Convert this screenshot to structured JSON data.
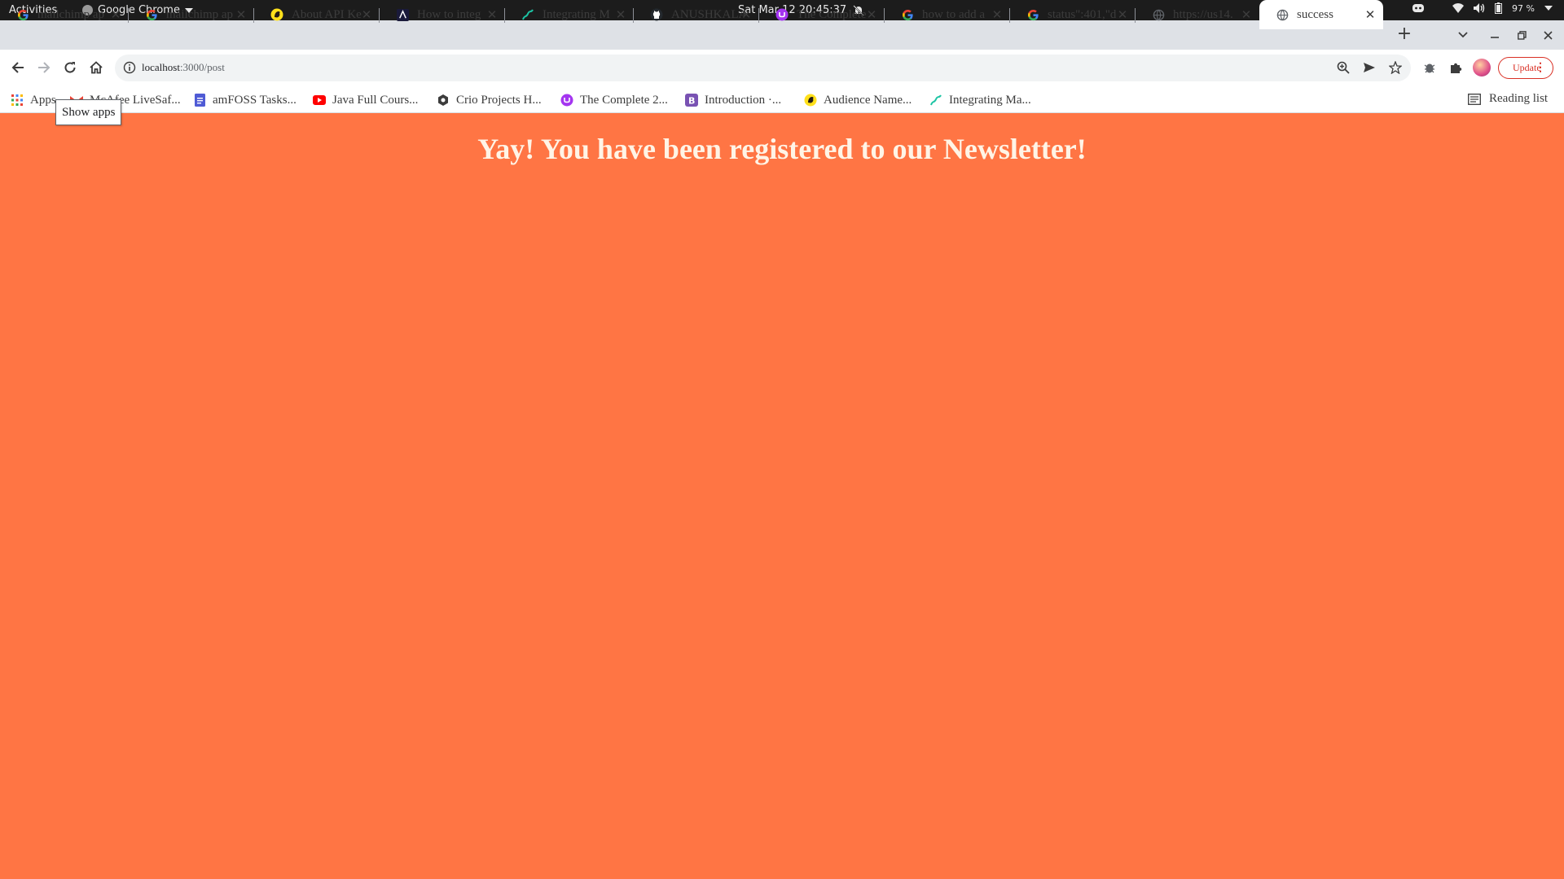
{
  "system_bar": {
    "activities": "Activities",
    "app_name": "Google Chrome",
    "clock": "Sat Mar 12  20:45:37",
    "battery": "97 %"
  },
  "tabs": [
    {
      "title": "mailchimp ap",
      "favicon": "google-icon"
    },
    {
      "title": "mailchimp ap",
      "favicon": "google-icon"
    },
    {
      "title": "About API Ke",
      "favicon": "mailchimp-icon"
    },
    {
      "title": "How to integ",
      "favicon": "dev-icon"
    },
    {
      "title": "Integrating M",
      "favicon": "integration-icon"
    },
    {
      "title": "ANUSHKALA",
      "favicon": "github-icon"
    },
    {
      "title": "The Complete",
      "favicon": "course-icon"
    },
    {
      "title": "how to add a",
      "favicon": "google-icon"
    },
    {
      "title": "status\":401,\"d",
      "favicon": "google-icon"
    },
    {
      "title": "https://us14.",
      "favicon": "globe-icon"
    },
    {
      "title": "success",
      "favicon": "globe-icon",
      "active": true
    }
  ],
  "toolbar": {
    "url_host": "localhost",
    "url_path": ":3000/post",
    "update_label": "Update"
  },
  "bookmarks": {
    "apps_label": "Apps",
    "items": [
      {
        "label": "McAfee LiveSaf...",
        "favicon": "gmail-icon"
      },
      {
        "label": "amFOSS Tasks...",
        "favicon": "docs-icon"
      },
      {
        "label": "Java Full Cours...",
        "favicon": "youtube-icon"
      },
      {
        "label": "Crio Projects H...",
        "favicon": "crio-icon"
      },
      {
        "label": "The Complete 2...",
        "favicon": "course-icon"
      },
      {
        "label": "Introduction ·...",
        "favicon": "bootstrap-icon"
      },
      {
        "label": "Audience Name...",
        "favicon": "mailchimp-icon"
      },
      {
        "label": "Integrating Ma...",
        "favicon": "integration-icon"
      }
    ],
    "reading_list": "Reading list"
  },
  "tooltip": "Show apps",
  "page": {
    "heading": "Yay! You have been registered to our Newsletter!",
    "background_color": "#ff7544"
  }
}
